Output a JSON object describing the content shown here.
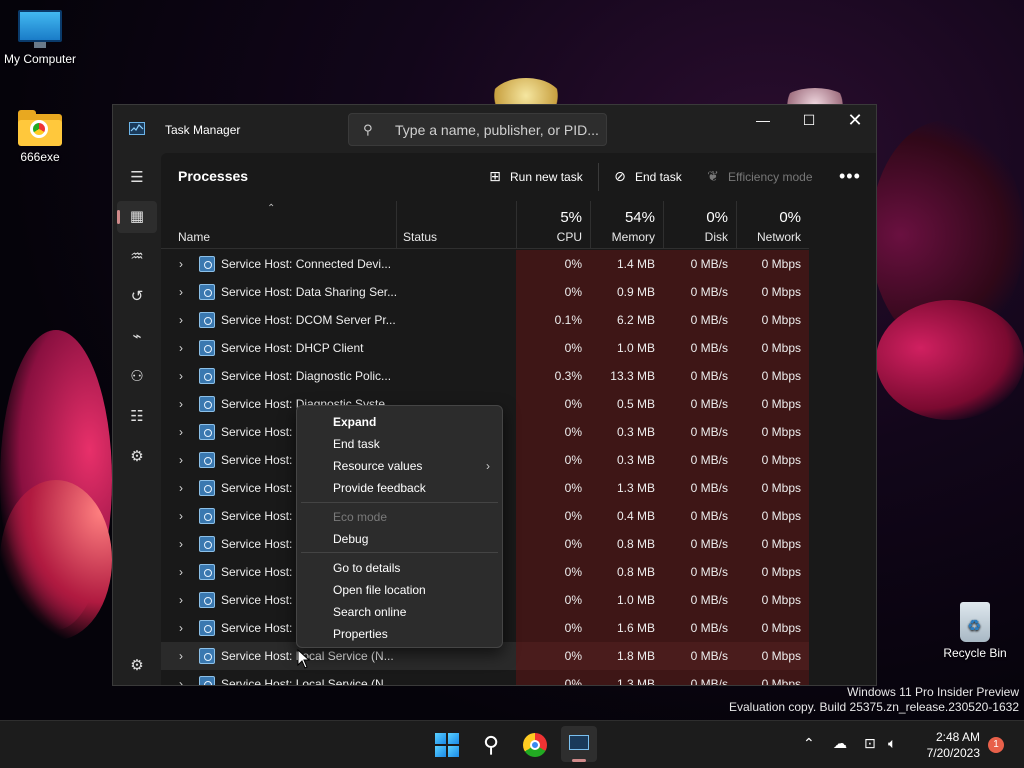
{
  "desktop": {
    "icons": [
      {
        "label": "My Computer"
      },
      {
        "label": "666exe"
      },
      {
        "label": "Recycle Bin"
      }
    ],
    "watermark": {
      "line1": "Windows 11 Pro Insider Preview",
      "line2": "Evaluation copy. Build 25375.zn_release.230520-1632"
    }
  },
  "window": {
    "title": "Task Manager",
    "search_placeholder": "Type a name, publisher, or PID...",
    "controls": {
      "minimize": "—",
      "maximize": "☐",
      "close": "✕"
    }
  },
  "nav": {
    "items": [
      {
        "icon": "hamburger-menu-icon",
        "glyph": "☰"
      },
      {
        "icon": "processes-icon",
        "glyph": "▦"
      },
      {
        "icon": "performance-icon",
        "glyph": "♒"
      },
      {
        "icon": "app-history-icon",
        "glyph": "↺"
      },
      {
        "icon": "startup-apps-icon",
        "glyph": "⌁"
      },
      {
        "icon": "users-icon",
        "glyph": "⚇"
      },
      {
        "icon": "details-icon",
        "glyph": "☷"
      },
      {
        "icon": "services-icon",
        "glyph": "⚙"
      },
      {
        "icon": "settings-icon",
        "glyph": "⚙"
      }
    ]
  },
  "commandbar": {
    "page_title": "Processes",
    "run_new_task": "Run new task",
    "end_task": "End task",
    "efficiency_mode": "Efficiency mode",
    "more": "•••"
  },
  "table": {
    "columns": {
      "name": "Name",
      "status": "Status",
      "cpu": {
        "pct": "5%",
        "label": "CPU"
      },
      "memory": {
        "pct": "54%",
        "label": "Memory"
      },
      "disk": {
        "pct": "0%",
        "label": "Disk"
      },
      "network": {
        "pct": "0%",
        "label": "Network"
      }
    },
    "rows": [
      {
        "name": "Service Host: Connected Devi...",
        "cpu": "0%",
        "memory": "1.4 MB",
        "disk": "0 MB/s",
        "network": "0 Mbps"
      },
      {
        "name": "Service Host: Data Sharing Ser...",
        "cpu": "0%",
        "memory": "0.9 MB",
        "disk": "0 MB/s",
        "network": "0 Mbps"
      },
      {
        "name": "Service Host: DCOM Server Pr...",
        "cpu": "0.1%",
        "memory": "6.2 MB",
        "disk": "0 MB/s",
        "network": "0 Mbps"
      },
      {
        "name": "Service Host: DHCP Client",
        "cpu": "0%",
        "memory": "1.0 MB",
        "disk": "0 MB/s",
        "network": "0 Mbps"
      },
      {
        "name": "Service Host: Diagnostic Polic...",
        "cpu": "0.3%",
        "memory": "13.3 MB",
        "disk": "0 MB/s",
        "network": "0 Mbps"
      },
      {
        "name": "Service Host: Diagnostic Syste...",
        "cpu": "0%",
        "memory": "0.5 MB",
        "disk": "0 MB/s",
        "network": "0 Mbps"
      },
      {
        "name": "Service Host: D",
        "cpu": "0%",
        "memory": "0.3 MB",
        "disk": "0 MB/s",
        "network": "0 Mbps"
      },
      {
        "name": "Service Host: D",
        "cpu": "0%",
        "memory": "0.3 MB",
        "disk": "0 MB/s",
        "network": "0 Mbps"
      },
      {
        "name": "Service Host: G",
        "cpu": "0%",
        "memory": "1.3 MB",
        "disk": "0 MB/s",
        "network": "0 Mbps"
      },
      {
        "name": "Service Host: II",
        "cpu": "0%",
        "memory": "0.4 MB",
        "disk": "0 MB/s",
        "network": "0 Mbps"
      },
      {
        "name": "Service Host: II",
        "cpu": "0%",
        "memory": "0.8 MB",
        "disk": "0 MB/s",
        "network": "0 Mbps"
      },
      {
        "name": "Service Host: II",
        "cpu": "0%",
        "memory": "0.8 MB",
        "disk": "0 MB/s",
        "network": "0 Mbps"
      },
      {
        "name": "Service Host: L",
        "cpu": "0%",
        "memory": "1.0 MB",
        "disk": "0 MB/s",
        "network": "0 Mbps"
      },
      {
        "name": "Service Host: L",
        "cpu": "0%",
        "memory": "1.6 MB",
        "disk": "0 MB/s",
        "network": "0 Mbps"
      },
      {
        "name": "Service Host: Local Service (N...",
        "cpu": "0%",
        "memory": "1.8 MB",
        "disk": "0 MB/s",
        "network": "0 Mbps"
      },
      {
        "name": "Service Host: Local Service (N...",
        "cpu": "0%",
        "memory": "1.3 MB",
        "disk": "0 MB/s",
        "network": "0 Mbps"
      }
    ]
  },
  "context_menu": {
    "items": [
      {
        "label": "Expand",
        "bold": true
      },
      {
        "label": "End task"
      },
      {
        "label": "Resource values",
        "submenu": true
      },
      {
        "label": "Provide feedback"
      },
      {
        "label": "Eco mode",
        "disabled": true
      },
      {
        "label": "Debug"
      },
      {
        "label": "Go to details"
      },
      {
        "label": "Open file location"
      },
      {
        "label": "Search online"
      },
      {
        "label": "Properties"
      }
    ]
  },
  "taskbar": {
    "time": "2:48 AM",
    "date": "7/20/2023",
    "notification_count": "1"
  }
}
